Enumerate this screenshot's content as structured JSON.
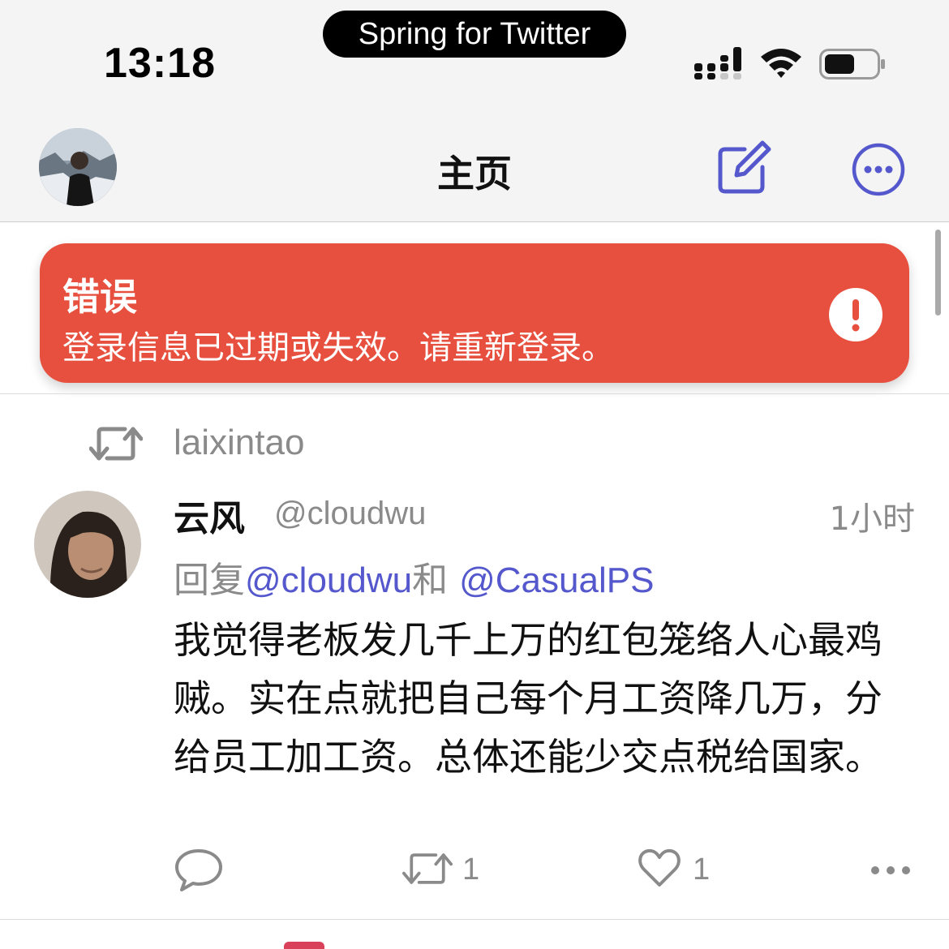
{
  "status_bar": {
    "time": "13:18",
    "app_pill": "Spring for Twitter",
    "signal_icon": "cellular-signal-icon",
    "wifi_icon": "wifi-icon",
    "battery_icon": "battery-icon"
  },
  "nav": {
    "title": "主页",
    "compose_icon": "compose-icon",
    "more_icon": "more-circle-icon",
    "accent_color": "#5458cc"
  },
  "error_toast": {
    "title": "错误",
    "message": "登录信息已过期或失效。请重新登录。",
    "color": "#e74f3e",
    "icon": "exclamation-icon"
  },
  "tweet": {
    "retweeted_by": "laixintao",
    "author_name": "云风",
    "author_handle": "@cloudwu",
    "time": "1小时",
    "reply_prefix": "回复",
    "reply_to_1": "@cloudwu",
    "reply_and": "和",
    "reply_to_2": "@CasualPS",
    "body": "我觉得老板发几千上万的红包笼络人心最鸡贼。实在点就把自己每个月工资降几万，分给员工加工资。总体还能少交点税给国家。",
    "reply_count": "",
    "retweet_count": "1",
    "like_count": "1"
  }
}
